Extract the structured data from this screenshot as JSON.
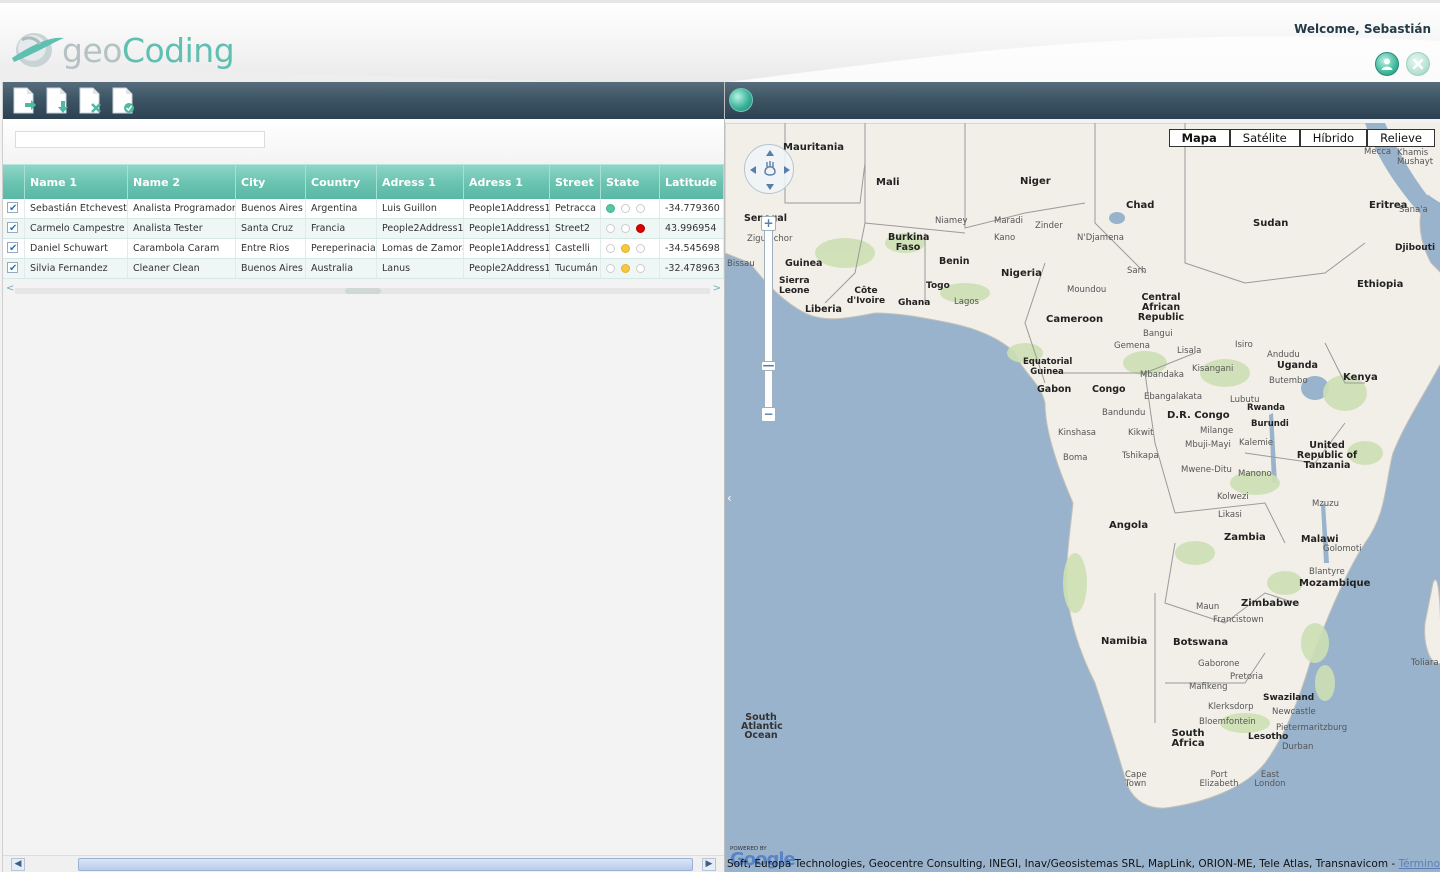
{
  "header": {
    "logo_geo": "geo",
    "logo_coding": "Coding",
    "welcome": "Welcome, Sebastián"
  },
  "toolbar": {
    "icons": [
      "new-document-icon",
      "edit-document-icon",
      "delete-document-icon",
      "accept-document-icon"
    ]
  },
  "filter": {
    "value": ""
  },
  "grid": {
    "columns": [
      "Name 1",
      "Name 2",
      "City",
      "Country",
      "Adress 1",
      "Adress 1",
      "Street",
      "State",
      "Latitude"
    ],
    "rows": [
      {
        "name1": "Sebastián Etchevest",
        "name2": "Analista Programador",
        "city": "Buenos Aires",
        "country": "Argentina",
        "adress1": "Luis Guillon",
        "adress2": "People1Address1",
        "street": "Petracca",
        "state": [
          "green",
          "off",
          "off"
        ],
        "latitude": "-34.779360"
      },
      {
        "name1": "Carmelo Campestre",
        "name2": "Analista Tester",
        "city": "Santa Cruz",
        "country": "Francia",
        "adress1": "People2Address1",
        "adress2": "People1Address1",
        "street": "Street2",
        "state": [
          "off",
          "off",
          "red"
        ],
        "latitude": "43.996954"
      },
      {
        "name1": "Daniel Schuwart",
        "name2": "Carambola Caram",
        "city": "Entre Rios",
        "country": "Pereperinacia",
        "adress1": "Lomas de Zamora",
        "adress2": "People1Address1",
        "street": "Castelli",
        "state": [
          "off",
          "yellow",
          "off"
        ],
        "latitude": "-34.545698"
      },
      {
        "name1": "Silvia Fernandez",
        "name2": "Cleaner Clean",
        "city": "Buenos Aires",
        "country": "Australia",
        "adress1": "Lanus",
        "adress2": "People2Address1",
        "street": "Tucumán",
        "state": [
          "off",
          "yellow",
          "off"
        ],
        "latitude": "-32.478963"
      }
    ]
  },
  "state_colors": {
    "green": "#55c8a3",
    "yellow": "#f5c842",
    "red": "#e00000"
  },
  "map": {
    "types": [
      "Mapa",
      "Satélite",
      "Híbrido",
      "Relieve"
    ],
    "selected_type": "Mapa",
    "countries": [
      {
        "text": "Mauritania"
      },
      {
        "text": "Mali"
      },
      {
        "text": "Niger"
      },
      {
        "text": "Chad"
      },
      {
        "text": "Sudan"
      },
      {
        "text": "Eritrea"
      },
      {
        "text": "Djibouti"
      },
      {
        "text": "Ethiopia"
      },
      {
        "text": "Burkina Faso"
      },
      {
        "text": "Benin"
      },
      {
        "text": "Nigeria"
      },
      {
        "text": "Guinea"
      },
      {
        "text": "Sierra Leone"
      },
      {
        "text": "Liberia"
      },
      {
        "text": "Côte d'Ivoire"
      },
      {
        "text": "Ghana"
      },
      {
        "text": "Togo"
      },
      {
        "text": "Central African Republic"
      },
      {
        "text": "Cameroon"
      },
      {
        "text": "Equatorial Guinea"
      },
      {
        "text": "Gabon"
      },
      {
        "text": "Congo"
      },
      {
        "text": "D.R. Congo"
      },
      {
        "text": "Uganda"
      },
      {
        "text": "Kenya"
      },
      {
        "text": "Rwanda"
      },
      {
        "text": "Burundi"
      },
      {
        "text": "United Republic of Tanzania"
      },
      {
        "text": "Angola"
      },
      {
        "text": "Zambia"
      },
      {
        "text": "Malawi"
      },
      {
        "text": "Mozambique"
      },
      {
        "text": "Zimbabwe"
      },
      {
        "text": "Namibia"
      },
      {
        "text": "Botswana"
      },
      {
        "text": "Swaziland"
      },
      {
        "text": "South Africa"
      },
      {
        "text": "Lesotho"
      },
      {
        "text": "Senegal"
      }
    ],
    "cities": [
      {
        "text": "Niamey"
      },
      {
        "text": "Zinder"
      },
      {
        "text": "Maradi"
      },
      {
        "text": "Kano"
      },
      {
        "text": "N'Djamena"
      },
      {
        "text": "Sarh"
      },
      {
        "text": "Moundou"
      },
      {
        "text": "Lagos"
      },
      {
        "text": "Bangui"
      },
      {
        "text": "Gemena"
      },
      {
        "text": "Lisala"
      },
      {
        "text": "Isiro"
      },
      {
        "text": "Andudu"
      },
      {
        "text": "Mbandaka"
      },
      {
        "text": "Kisangani"
      },
      {
        "text": "Butembo"
      },
      {
        "text": "Ebangalakata"
      },
      {
        "text": "Lubutu"
      },
      {
        "text": "Bandundu"
      },
      {
        "text": "Kinshasa"
      },
      {
        "text": "Kikwit"
      },
      {
        "text": "Milange"
      },
      {
        "text": "Boma"
      },
      {
        "text": "Tshikapa"
      },
      {
        "text": "Mbuji-Mayi"
      },
      {
        "text": "Kalemie"
      },
      {
        "text": "Mwene-Ditu"
      },
      {
        "text": "Manono"
      },
      {
        "text": "Kolwezi"
      },
      {
        "text": "Likasi"
      },
      {
        "text": "Mzuzu"
      },
      {
        "text": "Golomoti"
      },
      {
        "text": "Blantyre"
      },
      {
        "text": "Maun"
      },
      {
        "text": "Francistown"
      },
      {
        "text": "Gaborone"
      },
      {
        "text": "Pretoria"
      },
      {
        "text": "Mafikeng"
      },
      {
        "text": "Klerksdorp"
      },
      {
        "text": "Newcastle"
      },
      {
        "text": "Bloemfontein"
      },
      {
        "text": "Pietermaritzburg"
      },
      {
        "text": "Durban"
      },
      {
        "text": "Cape Town"
      },
      {
        "text": "Port Elizabeth"
      },
      {
        "text": "East London"
      },
      {
        "text": "Khamis Mushayt"
      },
      {
        "text": "Sana'a"
      },
      {
        "text": "Mecca"
      },
      {
        "text": "Bissau"
      },
      {
        "text": "Ziguinchor"
      },
      {
        "text": "Toliara"
      }
    ],
    "ocean": "South Atlantic Ocean",
    "powered_by": "POWERED BY",
    "google": "Google",
    "attribution": "Soft, Europa Technologies, Geocentre Consulting, INEGI, Inav/Geosistemas SRL, MapLink, ORION-ME, Tele Atlas, Transnavicom - ",
    "terms": "Términos de uso",
    "colors": {
      "water": "#99b3cc",
      "land": "#f2efe9",
      "park": "#cde0b4",
      "border": "#9a9a9a"
    }
  }
}
